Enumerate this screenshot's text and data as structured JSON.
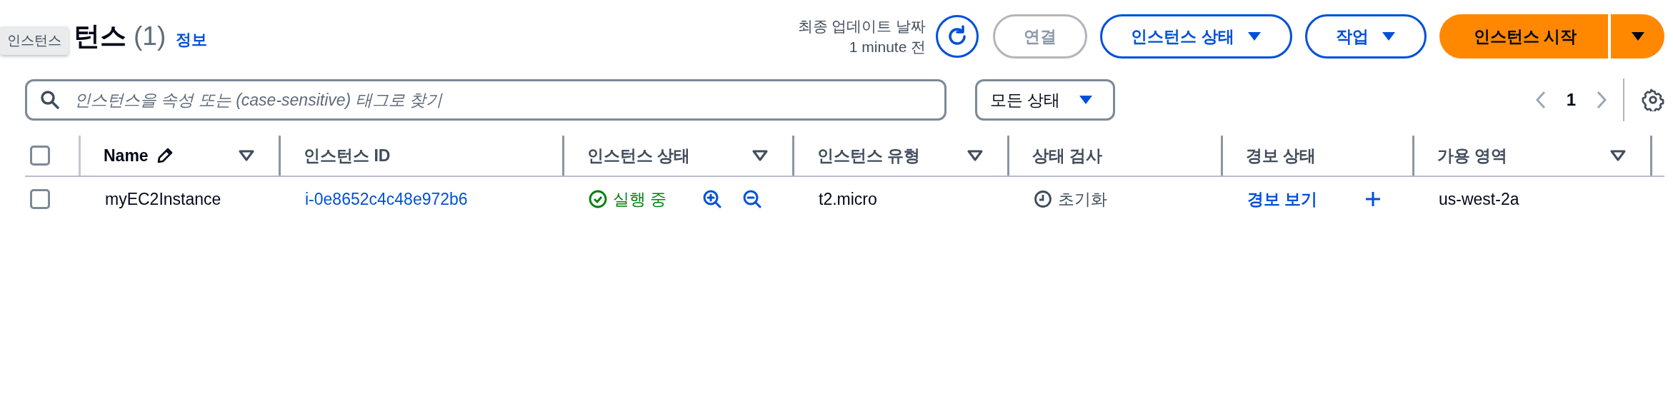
{
  "tooltip": "인스턴스",
  "header": {
    "title": "턴스",
    "count": "(1)",
    "info_link": "정보"
  },
  "last_updated": {
    "label": "최종 업데이트 날짜",
    "value": "1 minute 전"
  },
  "buttons": [
    {
      "kind": "refresh",
      "disabled": false
    },
    {
      "kind": "plain",
      "label": "연결",
      "disabled": true
    },
    {
      "kind": "dropdown",
      "label": "인스턴스 상태",
      "disabled": false
    },
    {
      "kind": "dropdown",
      "label": "작업",
      "disabled": false
    },
    {
      "kind": "primary-split",
      "label": "인스턴스 시작",
      "disabled": false
    }
  ],
  "search": {
    "placeholder": "인스턴스을 속성 또는 (case-sensitive) 태그로 찾기"
  },
  "state_filter": {
    "value": "모든 상태"
  },
  "pagination": {
    "page": "1"
  },
  "table": {
    "all_selected": false,
    "columns": [
      {
        "label": "Name",
        "editable": true,
        "filterable": true
      },
      {
        "label": "인스턴스 ID",
        "editable": false,
        "filterable": false
      },
      {
        "label": "인스턴스 상태",
        "editable": false,
        "filterable": true
      },
      {
        "label": "인스턴스 유형",
        "editable": false,
        "filterable": true
      },
      {
        "label": "상태 검사",
        "editable": false,
        "filterable": false
      },
      {
        "label": "경보 상태",
        "editable": false,
        "filterable": false
      },
      {
        "label": "가용 영역",
        "editable": false,
        "filterable": true
      }
    ],
    "rows": [
      {
        "selected": false,
        "name": "myEC2Instance",
        "instance_id": "i-0e8652c4c48e972b6",
        "state": "실행 중",
        "type": "t2.micro",
        "status_check": "초기화",
        "alarm_status": "경보 보기",
        "availability_zone": "us-west-2a"
      }
    ]
  }
}
